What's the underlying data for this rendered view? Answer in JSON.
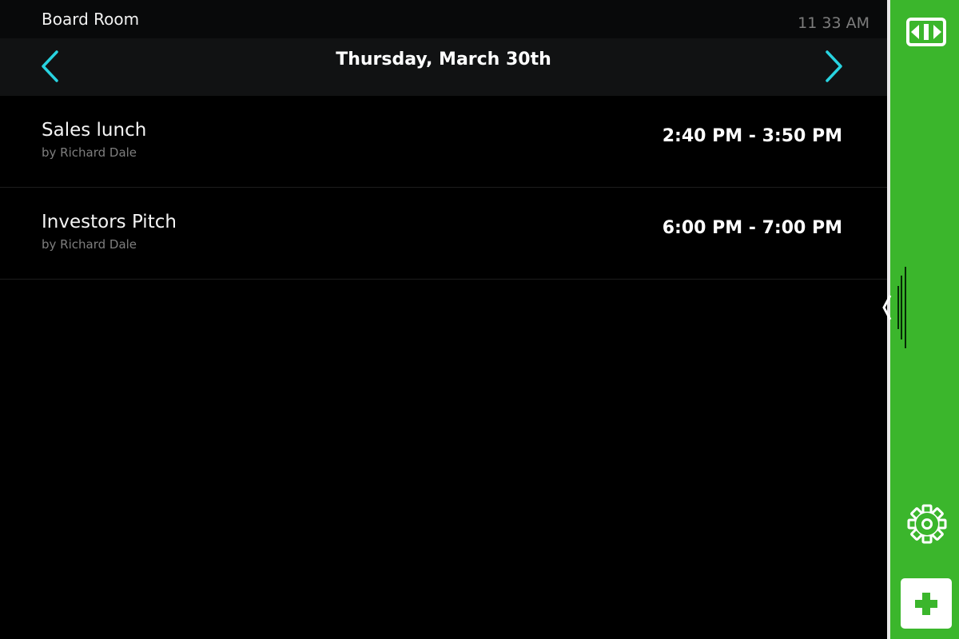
{
  "header": {
    "room_name": "Board Room",
    "clock": "11 33 AM"
  },
  "date_nav": {
    "date_label": "Thursday, March 30th",
    "prev_icon": "chevron-left-icon",
    "next_icon": "chevron-right-icon"
  },
  "events": [
    {
      "title": "Sales lunch",
      "organizer": "by Richard Dale",
      "time_range": "2:40 PM - 3:50 PM"
    },
    {
      "title": "Investors Pitch",
      "organizer": "by Richard Dale",
      "time_range": "6:00 PM - 7:00 PM"
    }
  ],
  "sidebar": {
    "logo_icon": "room-switch-logo-icon",
    "handle_icon": "panel-collapse-handle-icon",
    "settings_icon": "gear-icon",
    "add_icon": "plus-icon"
  },
  "colors": {
    "accent": "#28d3e0",
    "sidebar_green": "#3bb62c",
    "background": "#000000",
    "header_bg": "#111213",
    "muted_text": "#7e7e7e"
  }
}
